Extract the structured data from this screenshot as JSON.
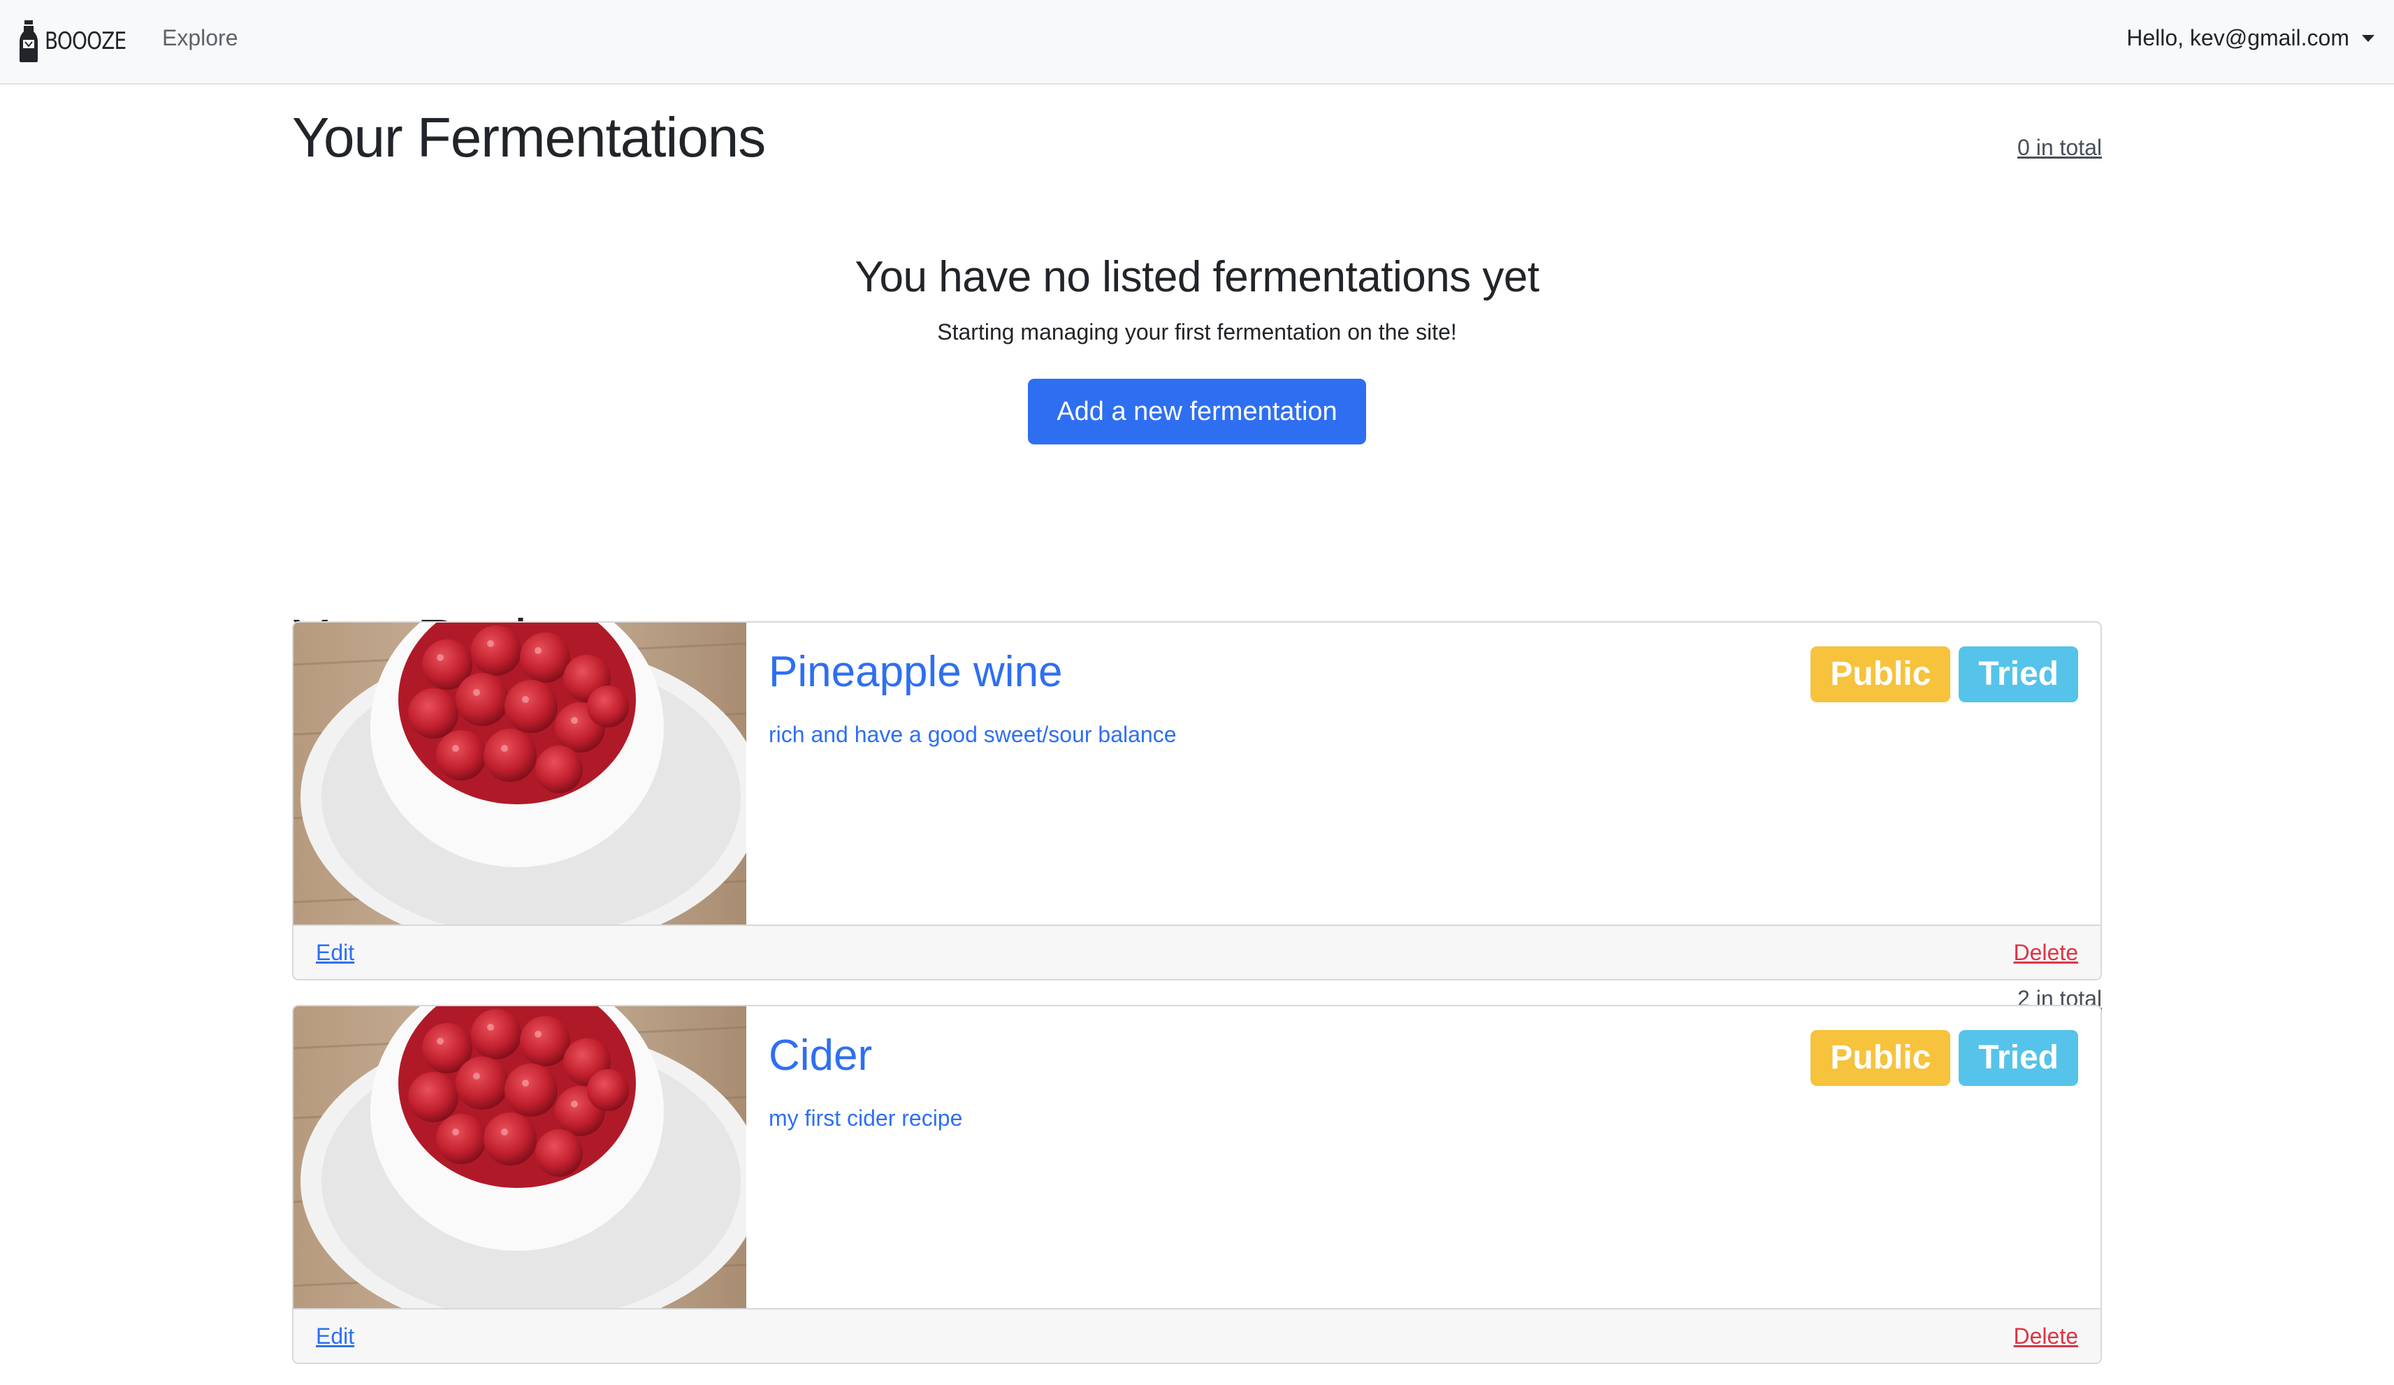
{
  "navbar": {
    "brand": "BOOOZE",
    "explore": "Explore",
    "user_greeting": "Hello, kev@gmail.com"
  },
  "fermentations": {
    "title": "Your Fermentations",
    "count": "0 in total",
    "empty_title": "You have no listed fermentations yet",
    "empty_text": "Starting managing your first fermentation on the site!",
    "add_button": "Add a new fermentation"
  },
  "recipes": {
    "title": "Your Recipes",
    "count": "2 in total",
    "items": [
      {
        "title": "Pineapple wine",
        "description": "rich and have a good sweet/sour balance",
        "badges": [
          "Public",
          "Tried"
        ],
        "edit": "Edit",
        "delete": "Delete"
      },
      {
        "title": "Cider",
        "description": "my first cider recipe",
        "badges": [
          "Public",
          "Tried"
        ],
        "edit": "Edit",
        "delete": "Delete"
      }
    ]
  },
  "colors": {
    "primary": "#2e6ff2",
    "badge_public": "#f7c23c",
    "badge_tried": "#56c3ea",
    "danger": "#dc3545"
  }
}
